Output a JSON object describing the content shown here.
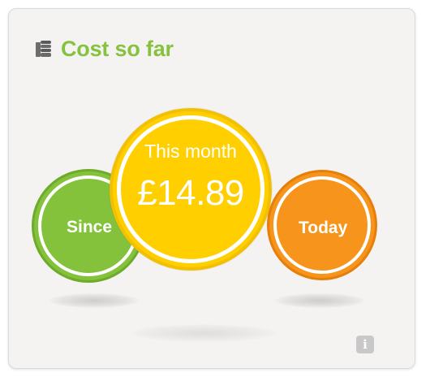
{
  "widget": {
    "title": "Cost so far",
    "icon": "coins-stack-icon"
  },
  "circles": {
    "since": {
      "label": "Since",
      "color": "#84c23b"
    },
    "this_month": {
      "label": "This month",
      "value": "£14.89",
      "color": "#ffcf00"
    },
    "today": {
      "label": "Today",
      "color": "#f6941c"
    }
  },
  "info": {
    "icon": "info-icon",
    "glyph": "i"
  },
  "colors": {
    "title": "#86c23f",
    "card_bg": "#f5f3f1"
  }
}
